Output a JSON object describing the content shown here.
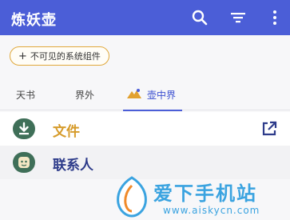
{
  "appbar": {
    "title": "炼妖壶",
    "color": "#4b5ed7",
    "actions": [
      "search-icon",
      "filter-icon",
      "more-vert-icon"
    ]
  },
  "chip": {
    "plus": "+",
    "label": "不可见的系统组件"
  },
  "tabs": [
    {
      "label": "天书",
      "selected": false
    },
    {
      "label": "界外",
      "selected": false
    },
    {
      "label": "壶中界",
      "selected": true,
      "icon": "mountain-icon"
    }
  ],
  "rows": [
    {
      "label": "文件",
      "icon": "download-icon",
      "trailing_icon": "open-external-icon"
    },
    {
      "label": "联系人",
      "icon": "contacts-icon"
    }
  ],
  "watermark": {
    "title": "爱下手机站",
    "url": "www.aiskycn.com"
  }
}
